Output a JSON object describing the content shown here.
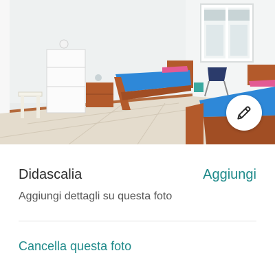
{
  "photo": {
    "alt": "",
    "edit_icon": "pencil-icon"
  },
  "caption": {
    "title": "Didascalia",
    "add_label": "Aggiungi",
    "hint": "Aggiungi dettagli su questa foto"
  },
  "actions": {
    "delete_label": "Cancella questa foto"
  },
  "colors": {
    "accent": "#1f8a8a",
    "text_primary": "#2b2b2b",
    "text_secondary": "#555555",
    "divider": "#e3e3e3"
  }
}
